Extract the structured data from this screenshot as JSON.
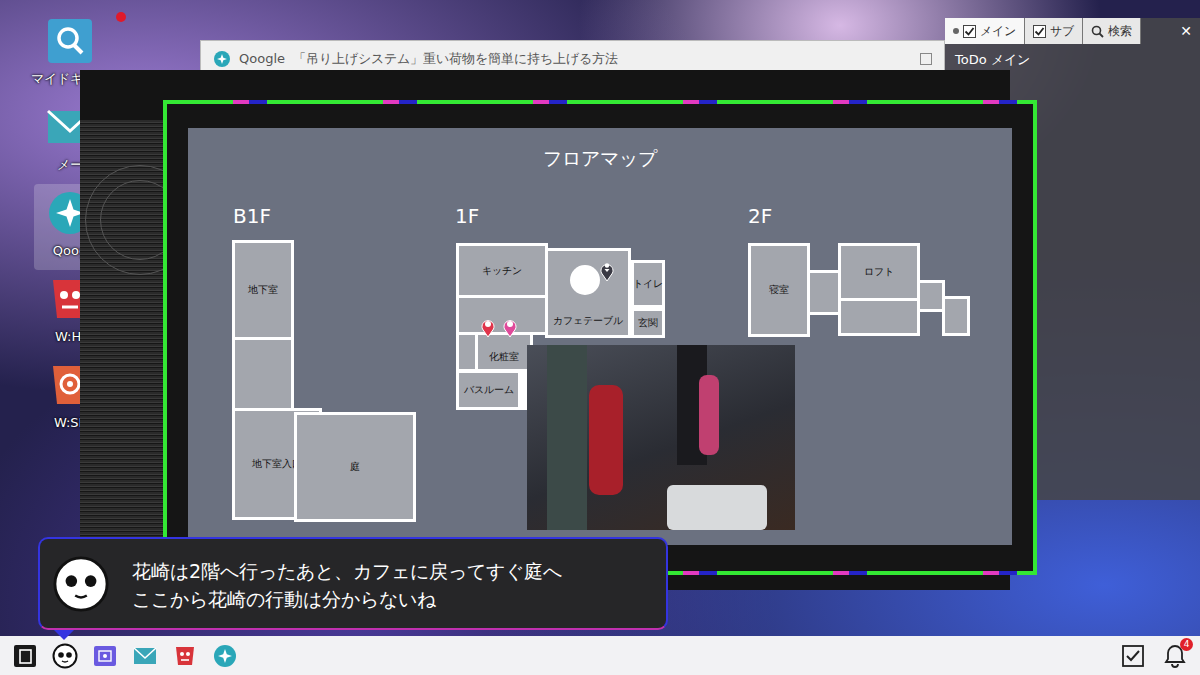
{
  "desktop": {
    "icons": [
      {
        "label": "マイドキュメ",
        "kind": "documents",
        "badge": true,
        "selected": false
      },
      {
        "label": "メー",
        "kind": "mail",
        "badge": false,
        "selected": false
      },
      {
        "label": "Qoog",
        "kind": "browser",
        "badge": false,
        "selected": true
      },
      {
        "label": "W:HI",
        "kind": "whi",
        "badge": false,
        "selected": false
      },
      {
        "label": "W:SF",
        "kind": "wsf",
        "badge": false,
        "selected": false
      }
    ]
  },
  "browser": {
    "logo": "Qoogle",
    "title": "「吊り上げシステム」重い荷物を簡単に持ち上げる方法",
    "url": "https://www....RopeWork..campmagazine..torisanbutasan....."
  },
  "todo": {
    "tabs": [
      {
        "label": "メイン",
        "kind": "check",
        "checked": true,
        "selected": true
      },
      {
        "label": "サブ",
        "kind": "check",
        "checked": true,
        "selected": false
      },
      {
        "label": "検索",
        "kind": "search",
        "selected": false
      }
    ],
    "close": "✕",
    "heading": "ToDo メイン"
  },
  "floormap": {
    "title": "フロアマップ",
    "floors": [
      {
        "label": "B1F",
        "rooms": [
          {
            "label": "地下室"
          },
          {
            "label": "地下室入口"
          },
          {
            "label": "庭"
          }
        ],
        "pins": []
      },
      {
        "label": "1F",
        "rooms": [
          {
            "label": "キッチン"
          },
          {
            "label": "カフェテーブル"
          },
          {
            "label": "トイレ"
          },
          {
            "label": "玄関"
          },
          {
            "label": "化粧室"
          },
          {
            "label": "バスルーム"
          }
        ],
        "pins": [
          {
            "kind": "marker",
            "color": "#3a3a44"
          },
          {
            "kind": "person",
            "color": "#e0344a"
          },
          {
            "kind": "person",
            "color": "#e04a9a"
          }
        ]
      },
      {
        "label": "2F",
        "rooms": [
          {
            "label": "寝室"
          },
          {
            "label": "ロフト"
          }
        ],
        "pins": []
      }
    ]
  },
  "dialog": {
    "lines": [
      "花崎は2階へ行ったあと、カフェに戻ってすぐ庭へ",
      "ここから花崎の行動は分からないね"
    ]
  },
  "taskbar": {
    "notifications": "4"
  }
}
